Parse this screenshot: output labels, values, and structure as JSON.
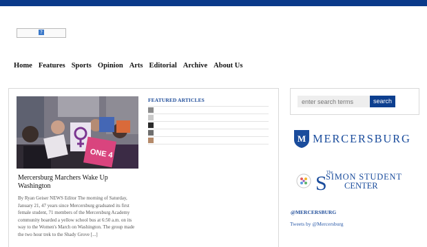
{
  "header": {
    "logo_glyph": "?"
  },
  "nav": {
    "items": [
      "Home",
      "Features",
      "Sports",
      "Opinion",
      "Arts",
      "Editorial",
      "Archive",
      "About Us"
    ]
  },
  "article": {
    "title": "Mercersburg Marchers Wake Up Washington",
    "body": "By Ryan Geiser NEWS Editor The morning of Saturday, January 21, 47 years since Mercersburg graduated its first female student, 71 members of the Mercersburg Academy community boarded a yellow school bus at 6:50 a.m. on its way to the Women's March on Washington. The group made the two hour trek to the Shady Grove [...]",
    "sign_text": "ONE 4"
  },
  "featured": {
    "heading": "FEATURED ARTICLES",
    "count": 5
  },
  "search": {
    "placeholder": "enter search terms",
    "button_label": "search"
  },
  "sidebar": {
    "mercersburg_logo_text": "MERCERSBURG",
    "shield_letter": "M",
    "simon_the": "The",
    "simon_top": "SIMON STUDENT",
    "simon_bottom": "CENTER",
    "mercersburg_handle": "@MERCERSBURG",
    "tweets_link": "Tweets by @Mercersburg"
  },
  "colors": {
    "brand_blue": "#0a3a8a",
    "link_blue": "#1f4d9a"
  }
}
